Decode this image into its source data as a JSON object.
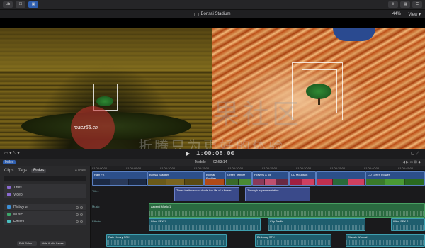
{
  "toolbar": {
    "lib_btn": "Lib",
    "view_btn": "",
    "share_btn": "",
    "right_btn_1": "",
    "right_btn_2": ""
  },
  "viewer": {
    "title": "Bonsai Stadium",
    "zoom": "44%",
    "view_menu": "View",
    "timecode": "1:00:08:00",
    "left_controls": "▭ ▾  ⤡ ▾",
    "right_controls": "▢ ⤢"
  },
  "timeline_header": {
    "index_tab": "Index",
    "project": "Mobile",
    "duration": "02:53:14",
    "right_controls": "◀ ▶ ▭ ⊞ ◆"
  },
  "index_panel": {
    "tabs": [
      "Clips",
      "Tags",
      "Roles"
    ],
    "count": "4 roles",
    "roles": [
      {
        "name": "Titles",
        "color": "#8a6ad0"
      },
      {
        "name": "Video",
        "color": "#8a6ad0"
      },
      {
        "name": "Dialogue",
        "color": "#3d8fd6"
      },
      {
        "name": "Music",
        "color": "#3ca66a"
      },
      {
        "name": "Effects",
        "color": "#4ac0c0"
      }
    ],
    "edit_roles": "Edit Roles...",
    "hide_audio": "Hide Audio Lanes"
  },
  "ruler": [
    "01:00:00:00",
    "01:00:05:00",
    "01:00:10:00",
    "01:00:15:00",
    "01:00:20:00",
    "01:00:25:00",
    "01:00:30:00",
    "01:00:35:00",
    "01:00:40:00",
    "01:00:45:00"
  ],
  "lanes": {
    "titles": "Titles",
    "music": "Music",
    "effects": "Effects"
  },
  "clips": {
    "video": [
      "Rain FX",
      "Bonsai Stadium",
      "Bonsai Rockies",
      "Green Texture",
      "Flowers & Ice",
      "CU Mountain",
      "",
      "CU Green Flower"
    ],
    "titles": [
      "Three instincts can divide the life of a flower",
      "Through experimentation"
    ],
    "music": [
      "Ascend Music 1"
    ],
    "effects": [
      "Wind SFX 1",
      "City Traffic",
      "Wind SFX 2",
      "Rain Heavy SFX",
      "Birdsong SFX",
      "Classic Whoosh"
    ]
  },
  "watermark": {
    "url": "macz65.cn",
    "line1": "果社区",
    "line2": "折腾只为更好的体验"
  }
}
